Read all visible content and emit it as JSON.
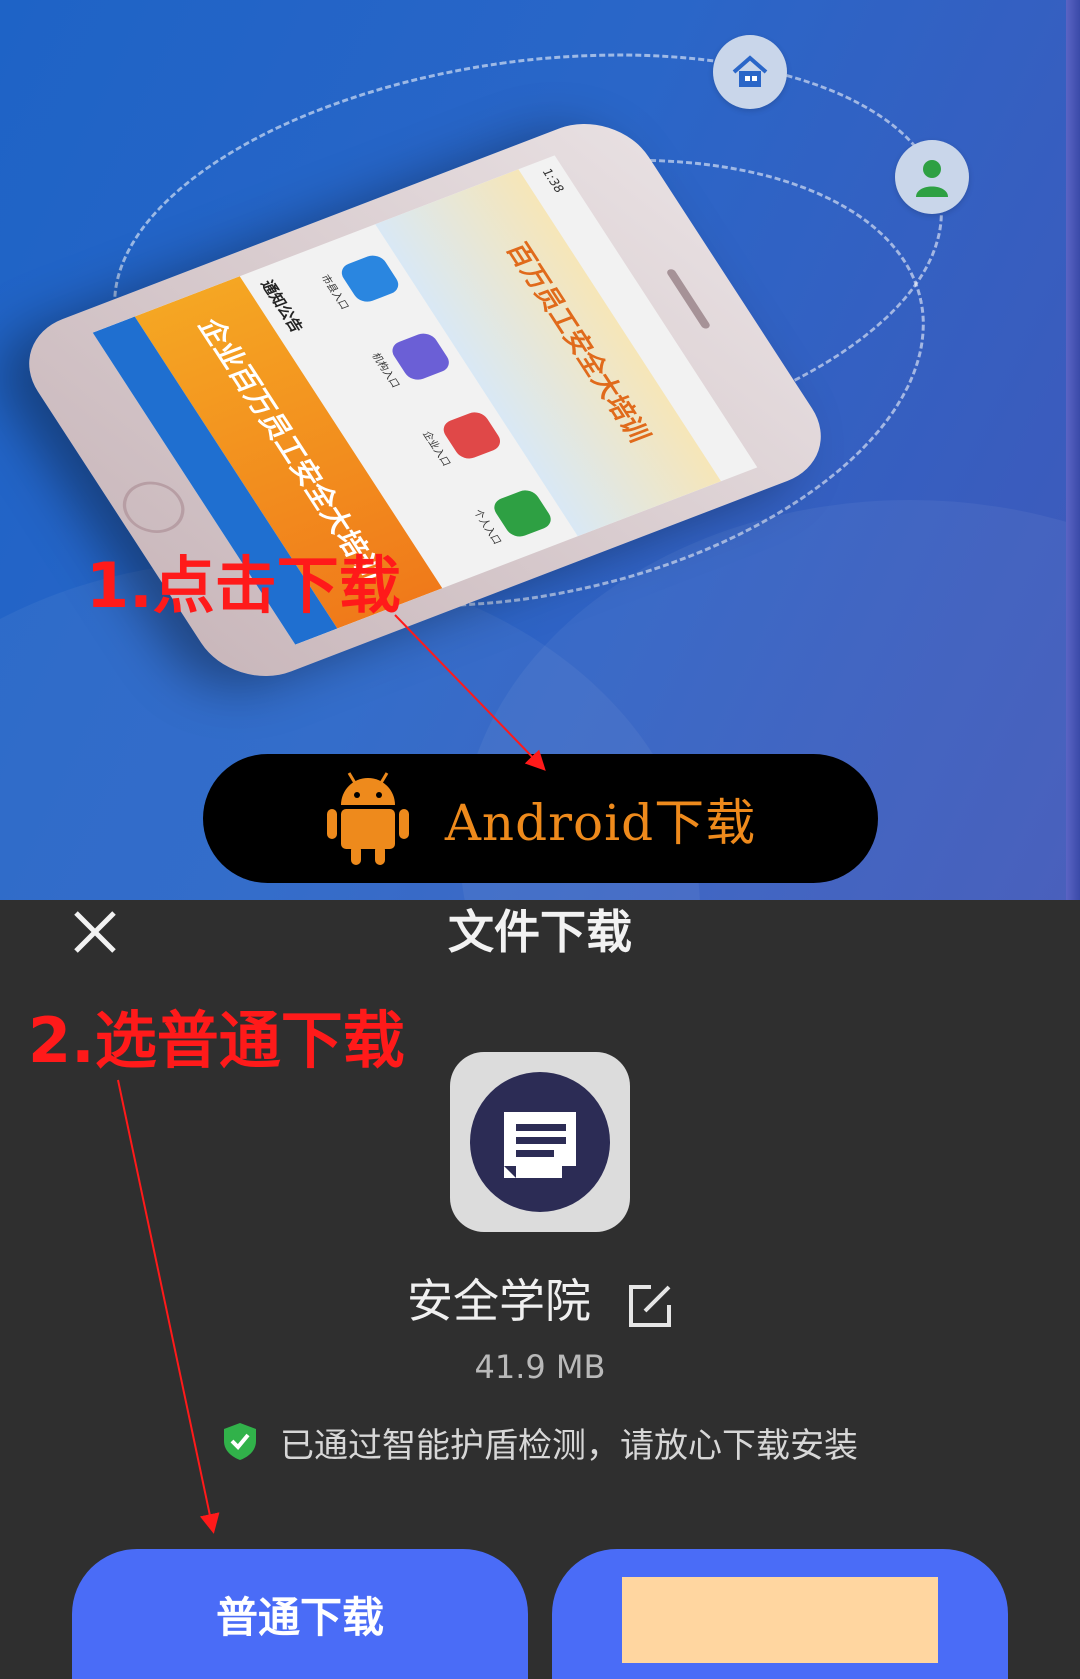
{
  "annotations": {
    "step1": "1.点击下载",
    "step2": "2.选普通下载"
  },
  "promo": {
    "phone_screen": {
      "time": "1:38",
      "banner_title": "百万员工安全大培训",
      "tiles": [
        "市县入口",
        "机构入口",
        "企业入口",
        "个人入口"
      ],
      "notice_title": "通知公告",
      "promo_card_title": "企业百万员工安全大培训"
    },
    "feature_icons": [
      "house-icon",
      "person-icon",
      "teacher-icon",
      "building-icon"
    ]
  },
  "android_button": {
    "label": "Android下载",
    "icon": "android-icon",
    "color": "#ee8a1c"
  },
  "dialog": {
    "title": "文件下载",
    "close_icon": "close-icon",
    "app_name": "安全学院",
    "app_size": "41.9 MB",
    "safety_text": "已通过智能护盾检测，请放心下载安装",
    "normal_download_label": "普通下载",
    "accent_color": "#4a6cf7"
  }
}
